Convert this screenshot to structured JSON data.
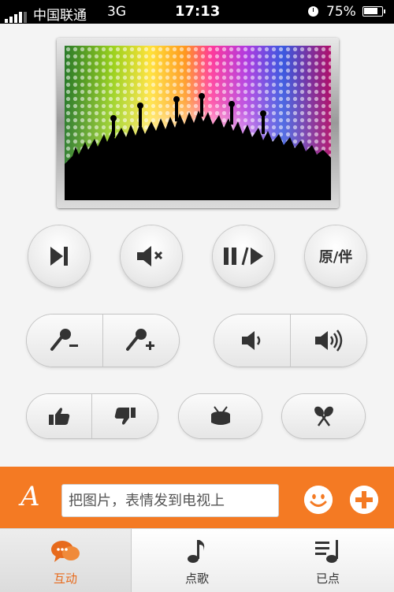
{
  "status_bar": {
    "carrier": "中国联通",
    "network": "3G",
    "time": "17:13",
    "battery": "75%"
  },
  "controls": {
    "next_icon": "skip-next-icon",
    "mute_icon": "mute-icon",
    "play_pause_icon": "play-pause-icon",
    "original_accompany_label": "原/伴",
    "mic_down_icon": "mic-volume-down-icon",
    "mic_up_icon": "mic-volume-up-icon",
    "vol_down_icon": "volume-down-icon",
    "vol_up_icon": "volume-up-icon",
    "thumbs_up_icon": "thumbs-up-icon",
    "thumbs_down_icon": "thumbs-down-icon",
    "drum_icon": "drum-icon",
    "shaker_icon": "maracas-icon"
  },
  "message_bar": {
    "font_label": "A",
    "placeholder": "把图片，表情发到电视上",
    "emoji_icon": "smiley-icon",
    "add_icon": "plus-icon"
  },
  "tabs": [
    {
      "label": "互动",
      "icon": "chat-bubbles-icon",
      "active": true
    },
    {
      "label": "点歌",
      "icon": "music-note-icon",
      "active": false
    },
    {
      "label": "已点",
      "icon": "playlist-icon",
      "active": false
    }
  ],
  "colors": {
    "accent": "#f47a23",
    "active_tab_text": "#e76a1c"
  }
}
